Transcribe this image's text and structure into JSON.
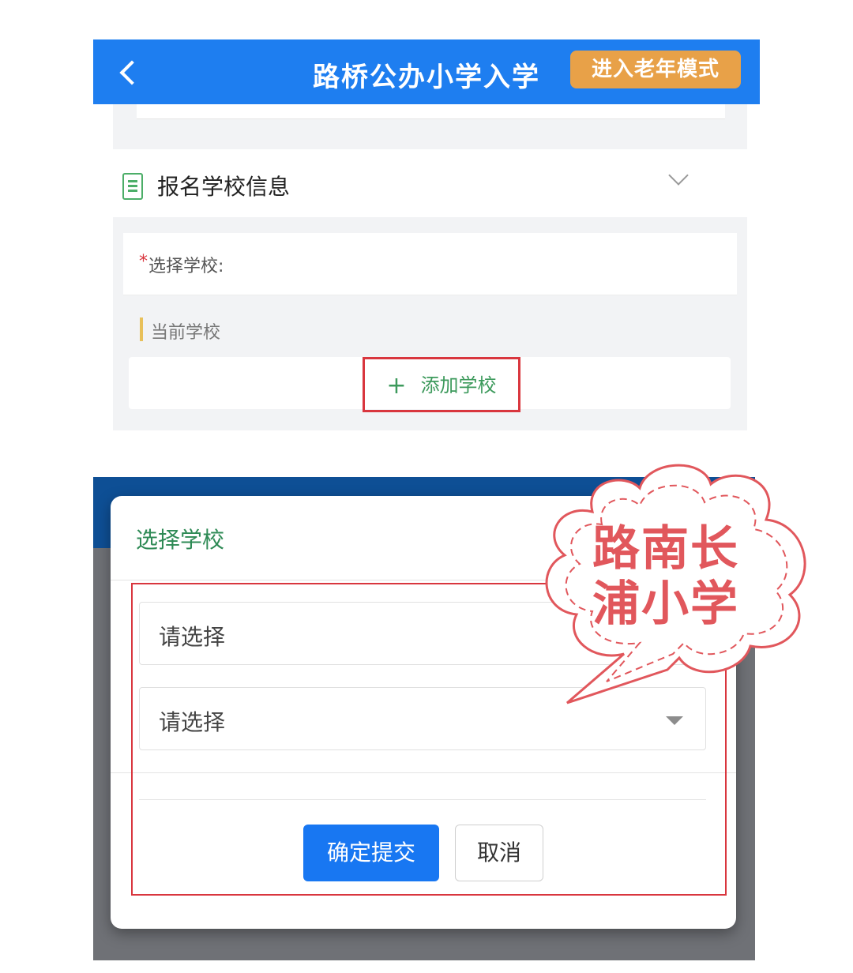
{
  "screen1": {
    "header": {
      "title": "路桥公办小学入学",
      "elder_mode_button": "进入老年模式",
      "back_icon": "chevron-left-icon"
    },
    "section": {
      "title": "报名学校信息",
      "icon": "document-icon",
      "expand_icon": "chevron-down-icon"
    },
    "form": {
      "required_mark": "*",
      "select_school_label": "选择学校:",
      "current_school_label": "当前学校",
      "add_school_button": {
        "icon_glyph": "+",
        "label": "添加学校"
      }
    }
  },
  "screen2": {
    "modal": {
      "title": "选择学校",
      "select1_placeholder": "请选择",
      "select2_placeholder": "请选择",
      "confirm_button": "确定提交",
      "cancel_button": "取消"
    }
  },
  "annotation": {
    "line1": "路南长",
    "line2": "浦小学"
  },
  "colors": {
    "header_blue": "#1e7ef0",
    "elder_orange": "#e8a148",
    "highlight_red": "#d9363e",
    "accent_green": "#2e8a55",
    "primary_button": "#1877f2",
    "annotation_pink": "#e1575c"
  }
}
